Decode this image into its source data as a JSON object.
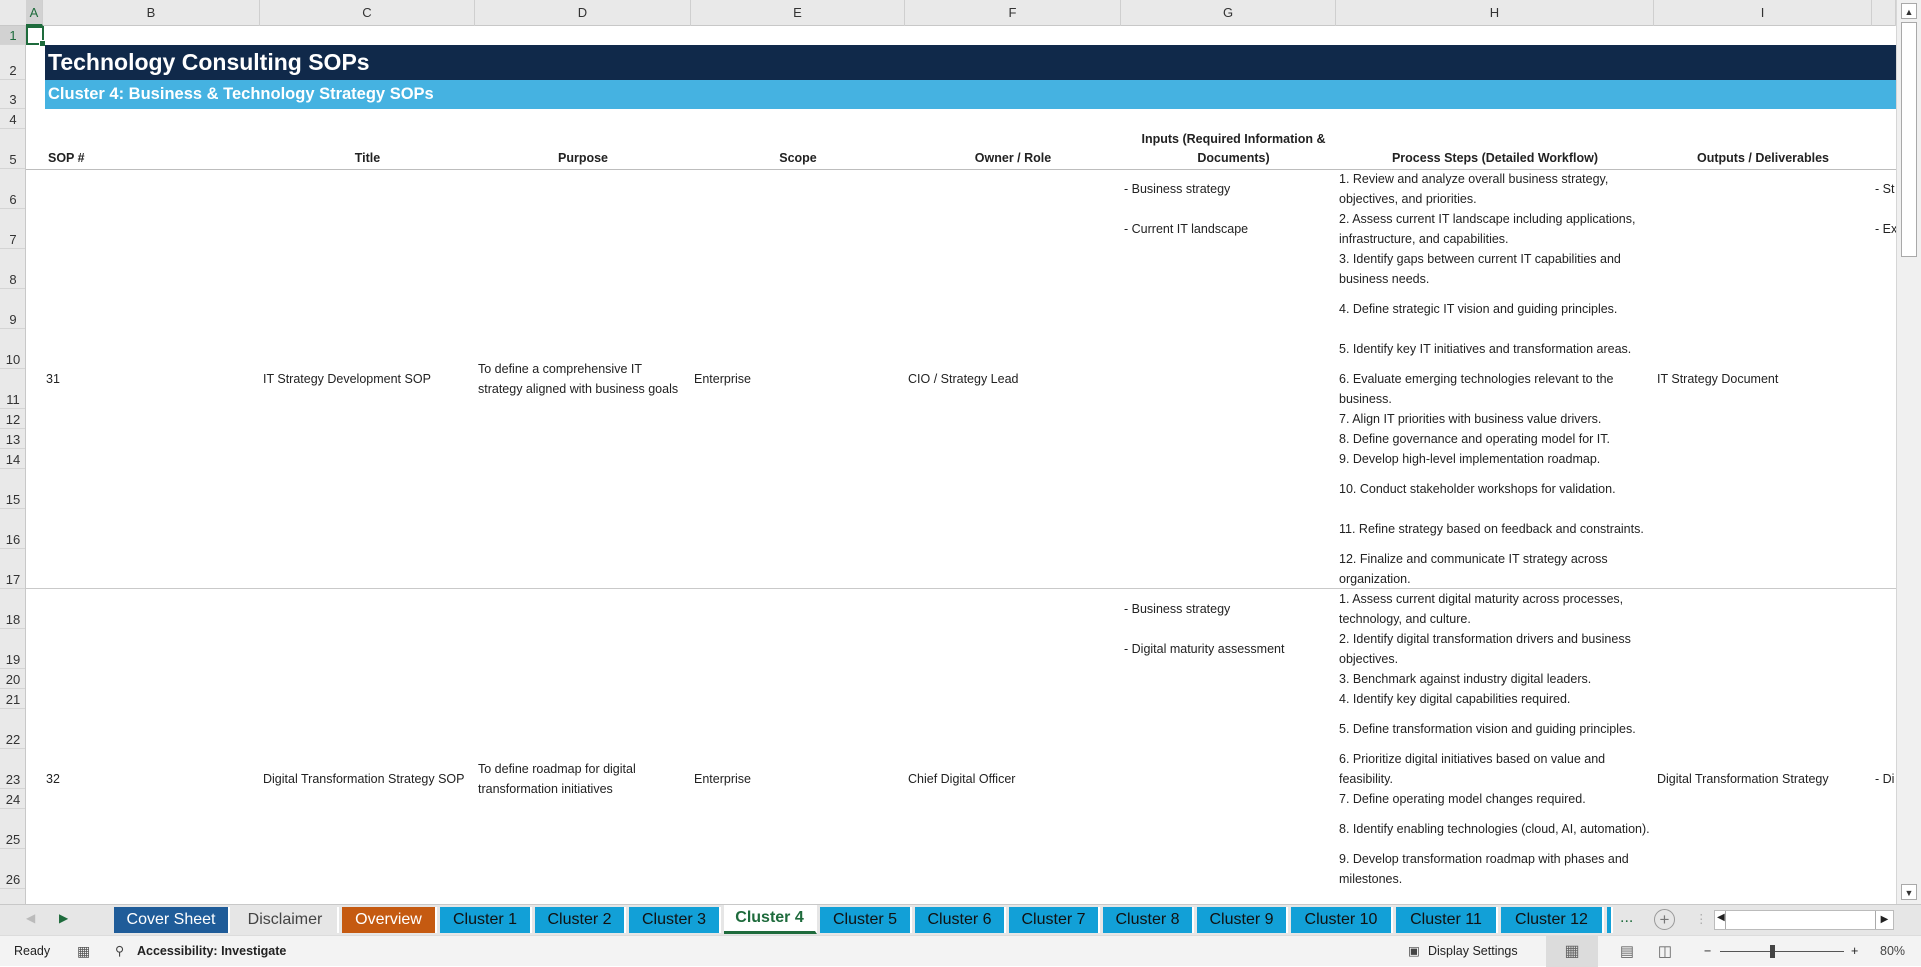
{
  "columns": [
    "A",
    "B",
    "C",
    "D",
    "E",
    "F",
    "G",
    "H",
    "I"
  ],
  "rows": [
    "1",
    "2",
    "3",
    "4",
    "5",
    "6",
    "7",
    "8",
    "9",
    "10",
    "11",
    "12",
    "13",
    "14",
    "15",
    "16",
    "17",
    "18",
    "19",
    "20",
    "21",
    "22",
    "23",
    "24",
    "25",
    "26"
  ],
  "title": "Technology Consulting SOPs",
  "subtitle": "Cluster 4: Business & Technology Strategy SOPs",
  "headers": {
    "sop": "SOP #",
    "title": "Title",
    "purpose": "Purpose",
    "scope": "Scope",
    "owner": "Owner / Role",
    "inputs": "Inputs (Required Information & Documents)",
    "steps": "Process Steps (Detailed Workflow)",
    "outputs": "Outputs / Deliverables"
  },
  "records": [
    {
      "sop": "31",
      "title": "IT Strategy Development SOP",
      "purpose": "To define a comprehensive IT strategy aligned with business goals",
      "scope": "Enterprise",
      "owner": "CIO / Strategy Lead",
      "inputs": [
        "- Business strategy",
        "- Current IT landscape"
      ],
      "steps": [
        "1. Review and analyze overall business strategy, objectives, and priorities.",
        "2. Assess current IT landscape including applications, infrastructure, and capabilities.",
        "3. Identify gaps between current IT capabilities and business needs.",
        "4. Define strategic IT vision and guiding principles.",
        "5. Identify key IT initiatives and transformation areas.",
        "6. Evaluate emerging technologies relevant to the business.",
        "7. Align IT priorities with business value drivers.",
        "8. Define governance and operating model for IT.",
        "9. Develop high-level implementation roadmap.",
        "10. Conduct stakeholder workshops for validation.",
        "11. Refine strategy based on feedback and constraints.",
        "12. Finalize and communicate IT strategy across organization."
      ],
      "outputs": "IT Strategy Document",
      "next_col_rows": [
        "- St",
        "- Ex"
      ]
    },
    {
      "sop": "32",
      "title": "Digital Transformation Strategy SOP",
      "purpose": "To define roadmap for digital transformation initiatives",
      "scope": "Enterprise",
      "owner": "Chief Digital Officer",
      "inputs": [
        "- Business strategy",
        "- Digital maturity assessment"
      ],
      "steps": [
        "1. Assess current digital maturity across processes, technology, and culture.",
        "2. Identify digital transformation drivers and business objectives.",
        "3. Benchmark against industry digital leaders.",
        "4. Identify key digital capabilities required.",
        "5. Define transformation vision and guiding principles.",
        "6. Prioritize digital initiatives based on value and feasibility.",
        "7. Define operating model changes required.",
        "8. Identify enabling technologies (cloud, AI, automation).",
        "9. Develop transformation roadmap with phases and milestones."
      ],
      "outputs": "Digital Transformation Strategy",
      "next_col_merged": "- Di"
    }
  ],
  "tabs": [
    {
      "label": "Cover Sheet",
      "color": "#1f5c99",
      "text": "#ffffff"
    },
    {
      "label": "Disclaimer",
      "color": "#e6e6e6",
      "text": "#444444"
    },
    {
      "label": "Overview",
      "color": "#c55a11",
      "text": "#ffffff"
    },
    {
      "label": "Cluster 1",
      "color": "#12a0d7",
      "text": "#111111"
    },
    {
      "label": "Cluster 2",
      "color": "#12a0d7",
      "text": "#111111"
    },
    {
      "label": "Cluster 3",
      "color": "#12a0d7",
      "text": "#111111"
    },
    {
      "label": "Cluster 4",
      "color": "#ffffff",
      "text": "#1e6b3c",
      "active": true
    },
    {
      "label": "Cluster 5",
      "color": "#12a0d7",
      "text": "#111111"
    },
    {
      "label": "Cluster 6",
      "color": "#12a0d7",
      "text": "#111111"
    },
    {
      "label": "Cluster 7",
      "color": "#12a0d7",
      "text": "#111111"
    },
    {
      "label": "Cluster 8",
      "color": "#12a0d7",
      "text": "#111111"
    },
    {
      "label": "Cluster 9",
      "color": "#12a0d7",
      "text": "#111111"
    },
    {
      "label": "Cluster 10",
      "color": "#12a0d7",
      "text": "#111111"
    },
    {
      "label": "Cluster 11",
      "color": "#12a0d7",
      "text": "#111111"
    },
    {
      "label": "Cluster 12",
      "color": "#12a0d7",
      "text": "#111111"
    }
  ],
  "tab_more": "...",
  "status": {
    "ready": "Ready",
    "accessibility": "Accessibility: Investigate",
    "display_settings": "Display Settings",
    "zoom": "80%",
    "zoom_minus": "−",
    "zoom_plus": "+"
  }
}
